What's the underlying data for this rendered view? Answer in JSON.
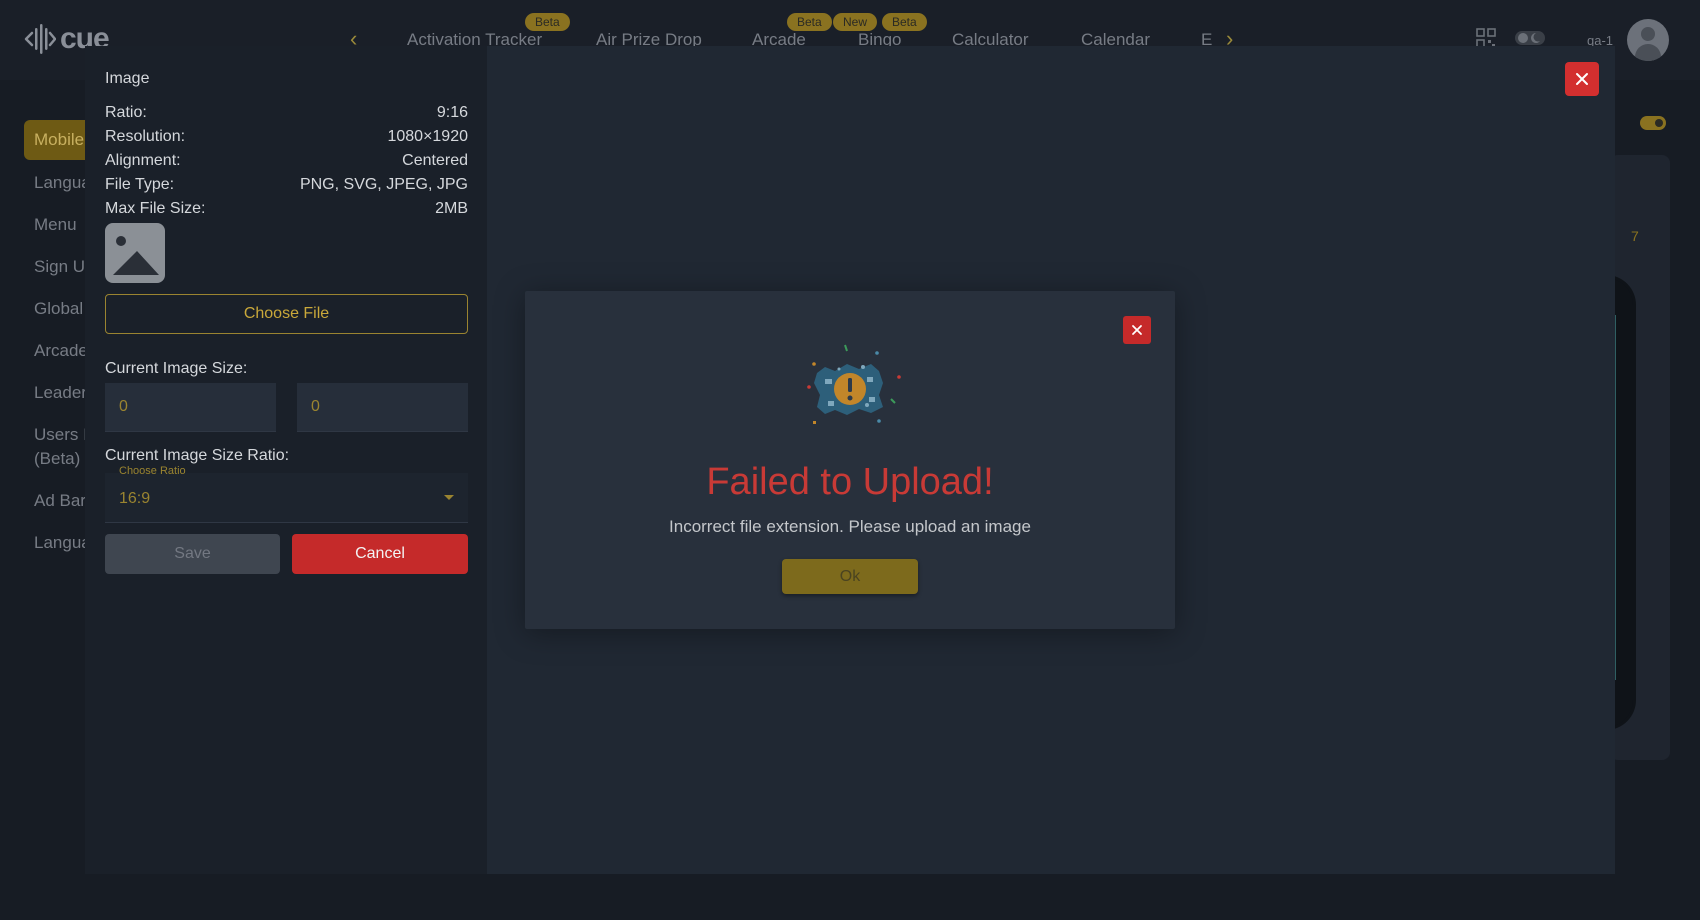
{
  "app": {
    "logo_text": "cue",
    "user": "qa-1"
  },
  "nav": {
    "tabs": [
      {
        "label": "Activation Tracker"
      },
      {
        "label": "Air Prize Drop"
      },
      {
        "label": "Arcade"
      },
      {
        "label": "Bingo"
      },
      {
        "label": "Calculator"
      },
      {
        "label": "Calendar"
      },
      {
        "label": "E"
      }
    ],
    "badges": [
      "Beta",
      "Beta",
      "New",
      "Beta"
    ]
  },
  "sidebar": {
    "items": [
      {
        "label": "Mobile"
      },
      {
        "label": "Langua"
      },
      {
        "label": "Menu"
      },
      {
        "label": "Sign U"
      },
      {
        "label": "Global"
      },
      {
        "label": "Arcade"
      },
      {
        "label": "Leader"
      },
      {
        "label": "Users I"
      },
      {
        "label": "(Beta)"
      },
      {
        "label": "Ad Bar"
      },
      {
        "label": "Langua"
      }
    ]
  },
  "background": {
    "number": "7"
  },
  "image_panel": {
    "title": "Image",
    "specs": [
      {
        "label": "Ratio:",
        "value": "9:16"
      },
      {
        "label": "Resolution:",
        "value": "1080×1920"
      },
      {
        "label": "Alignment:",
        "value": "Centered"
      },
      {
        "label": "File Type:",
        "value": "PNG, SVG, JPEG, JPG"
      },
      {
        "label": "Max File Size:",
        "value": "2MB"
      }
    ],
    "choose_file_label": "Choose File",
    "current_size_label": "Current Image Size:",
    "width_value": "0",
    "height_value": "0",
    "ratio_label": "Current Image Size Ratio:",
    "ratio_select_label": "Choose Ratio",
    "ratio_value": "16:9",
    "save_label": "Save",
    "cancel_label": "Cancel"
  },
  "error_dialog": {
    "title": "Failed to Upload!",
    "message": "Incorrect file extension. Please upload an image",
    "ok_label": "Ok"
  },
  "colors": {
    "accent": "#9a8430",
    "danger": "#c52a2a",
    "error_title": "#c83a36",
    "modal_bg": "#202833",
    "panel_bg": "#1a2029"
  }
}
